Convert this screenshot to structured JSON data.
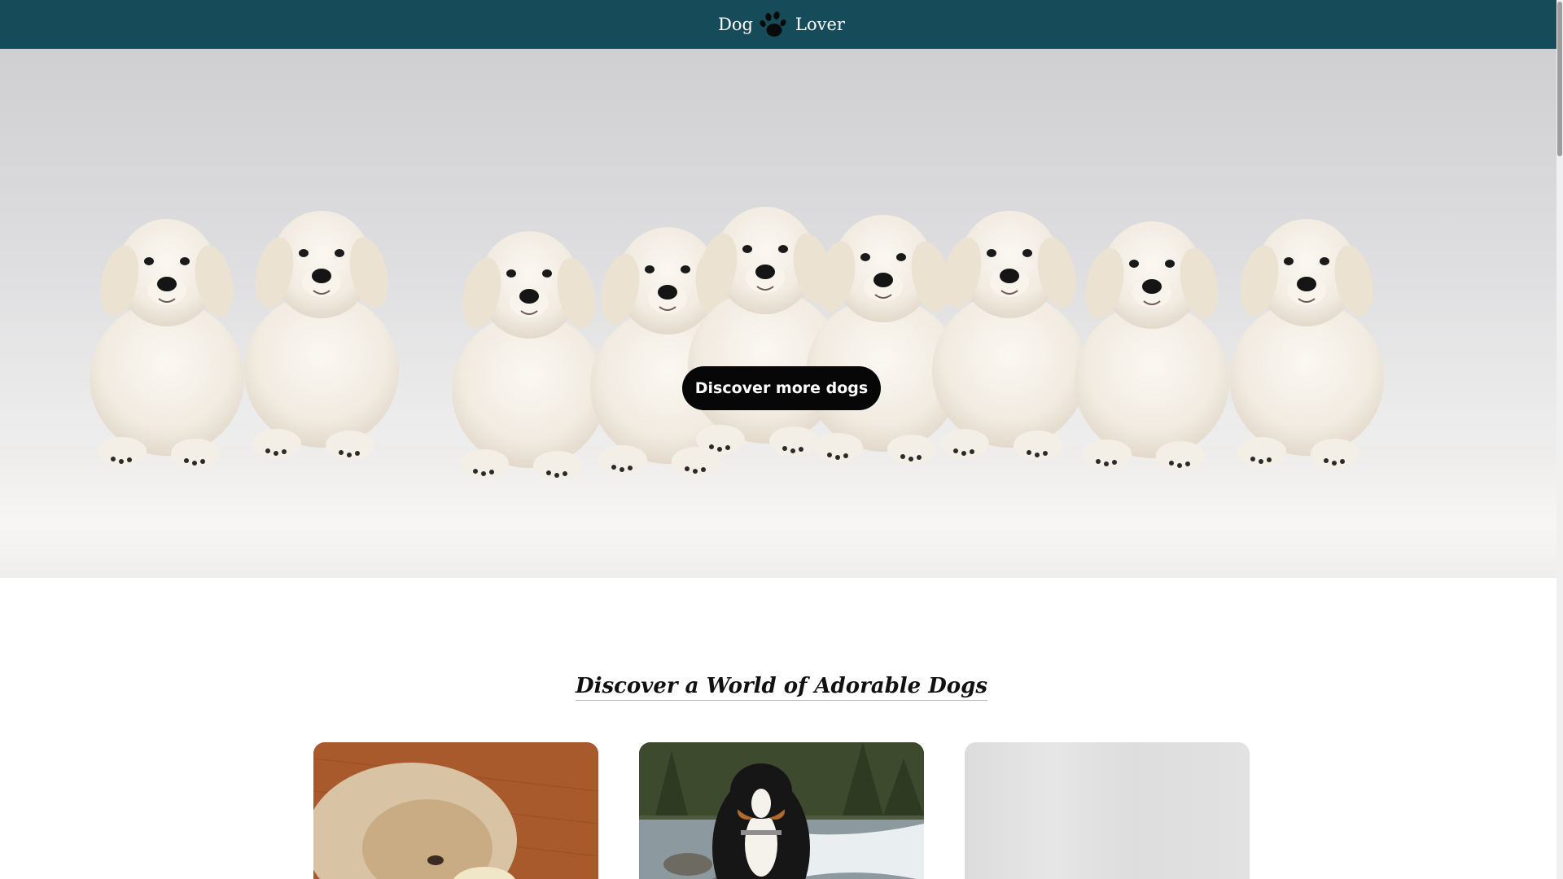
{
  "header": {
    "brand_left": "Dog",
    "brand_right": "Lover",
    "logo_icon": "paw-icon",
    "background": "#164b5a"
  },
  "hero": {
    "image": "golden-retriever-puppies-row",
    "cta_label": "Discover more dogs"
  },
  "section": {
    "title": "Discover a World of Adorable Dogs",
    "cards": [
      {
        "image": "fluffy-dog-sleeping-on-rug",
        "state": "loaded"
      },
      {
        "image": "swiss-mountain-dog-by-river",
        "state": "loaded"
      },
      {
        "image": "image-placeholder",
        "state": "loading"
      }
    ]
  },
  "colors": {
    "accent": "#164b5a",
    "cta_background": "#070707",
    "cta_text": "#ffffff"
  }
}
